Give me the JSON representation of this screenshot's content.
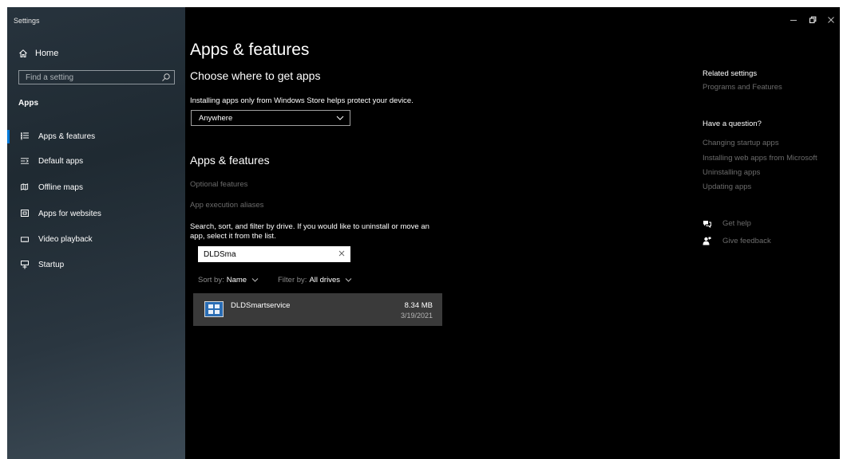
{
  "window": {
    "title": "Settings"
  },
  "sidebar": {
    "home_label": "Home",
    "search_placeholder": "Find a setting",
    "section_title": "Apps",
    "items": [
      {
        "label": "Apps & features",
        "icon": "apps-features-icon",
        "selected": true
      },
      {
        "label": "Default apps",
        "icon": "default-apps-icon"
      },
      {
        "label": "Offline maps",
        "icon": "offline-maps-icon"
      },
      {
        "label": "Apps for websites",
        "icon": "apps-for-websites-icon"
      },
      {
        "label": "Video playback",
        "icon": "video-playback-icon"
      },
      {
        "label": "Startup",
        "icon": "startup-icon"
      }
    ]
  },
  "main": {
    "page_title": "Apps & features",
    "source_heading": "Choose where to get apps",
    "source_description": "Installing apps only from Windows Store helps protect your device.",
    "source_selected": "Anywhere",
    "apps_heading": "Apps & features",
    "optional_features_link": "Optional features",
    "execution_aliases_link": "App execution aliases",
    "search_description": "Search, sort, and filter by drive. If you would like to uninstall or move an app, select it from the list.",
    "app_search_value": "DLDSma",
    "sort_label": "Sort by:",
    "sort_value": "Name",
    "filter_label": "Filter by:",
    "filter_value": "All drives",
    "apps": [
      {
        "name": "DLDSmartservice",
        "size": "8.34 MB",
        "date": "3/19/2021"
      }
    ]
  },
  "related": {
    "heading": "Related settings",
    "programs_link": "Programs and Features",
    "question_heading": "Have a question?",
    "question_links": [
      "Changing startup apps",
      "Installing web apps from Microsoft",
      "Uninstalling apps",
      "Updating apps"
    ],
    "get_help": "Get help",
    "give_feedback": "Give feedback"
  },
  "colors": {
    "accent": "#0078d7",
    "background": "#000000",
    "link_gray": "#6c6c6c",
    "selected_item": "#3a3a3a"
  }
}
